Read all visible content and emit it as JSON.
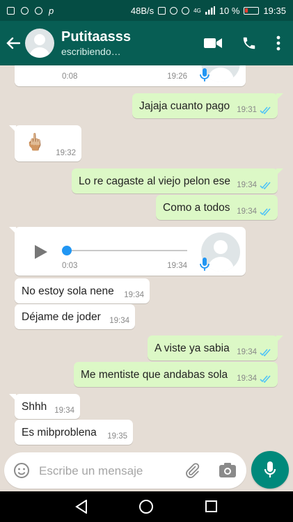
{
  "status_bar": {
    "speed": "48B/s",
    "network": "4G",
    "battery": "10 %",
    "time": "19:35"
  },
  "header": {
    "contact_name": "Putitaasss",
    "contact_status": "escribiendo…"
  },
  "messages": [
    {
      "kind": "voice",
      "dir": "in",
      "duration": "0:08",
      "time": "19:26"
    },
    {
      "kind": "text",
      "dir": "out",
      "text": "Jajaja cuanto pago",
      "time": "19:31",
      "status": "read"
    },
    {
      "kind": "emoji",
      "dir": "in",
      "text": "🖕🏼",
      "time": "19:32"
    },
    {
      "kind": "text",
      "dir": "out",
      "text": "Lo re cagaste al viejo pelon ese",
      "time": "19:34",
      "status": "read"
    },
    {
      "kind": "text",
      "dir": "out",
      "text": "Como a todos",
      "time": "19:34",
      "status": "read"
    },
    {
      "kind": "voice",
      "dir": "in",
      "duration": "0:03",
      "time": "19:34",
      "progress": 0
    },
    {
      "kind": "text",
      "dir": "in",
      "text": "No estoy sola nene",
      "time": "19:34"
    },
    {
      "kind": "text",
      "dir": "in",
      "text": "Déjame de joder",
      "time": "19:34"
    },
    {
      "kind": "text",
      "dir": "out",
      "text": "A viste ya sabia",
      "time": "19:34",
      "status": "read"
    },
    {
      "kind": "text",
      "dir": "out",
      "text": "Me mentiste que andabas sola",
      "time": "19:34",
      "status": "read"
    },
    {
      "kind": "text",
      "dir": "in",
      "text": "Shhh",
      "time": "19:34"
    },
    {
      "kind": "text",
      "dir": "in",
      "text": "Es mibproblena",
      "time": "19:35"
    }
  ],
  "input": {
    "placeholder": "Escribe un mensaje"
  },
  "colors": {
    "header": "#075e54",
    "statusbar": "#054d44",
    "outgoing": "#dcf8c6",
    "incoming": "#ffffff",
    "accent": "#00897b",
    "read_ticks": "#4fc3f7",
    "wallpaper": "#e5ddd5"
  },
  "icons": [
    "back-arrow-icon",
    "video-call-icon",
    "phone-icon",
    "more-vert-icon",
    "play-icon",
    "mic-icon",
    "emoji-icon",
    "attach-icon",
    "camera-icon"
  ]
}
